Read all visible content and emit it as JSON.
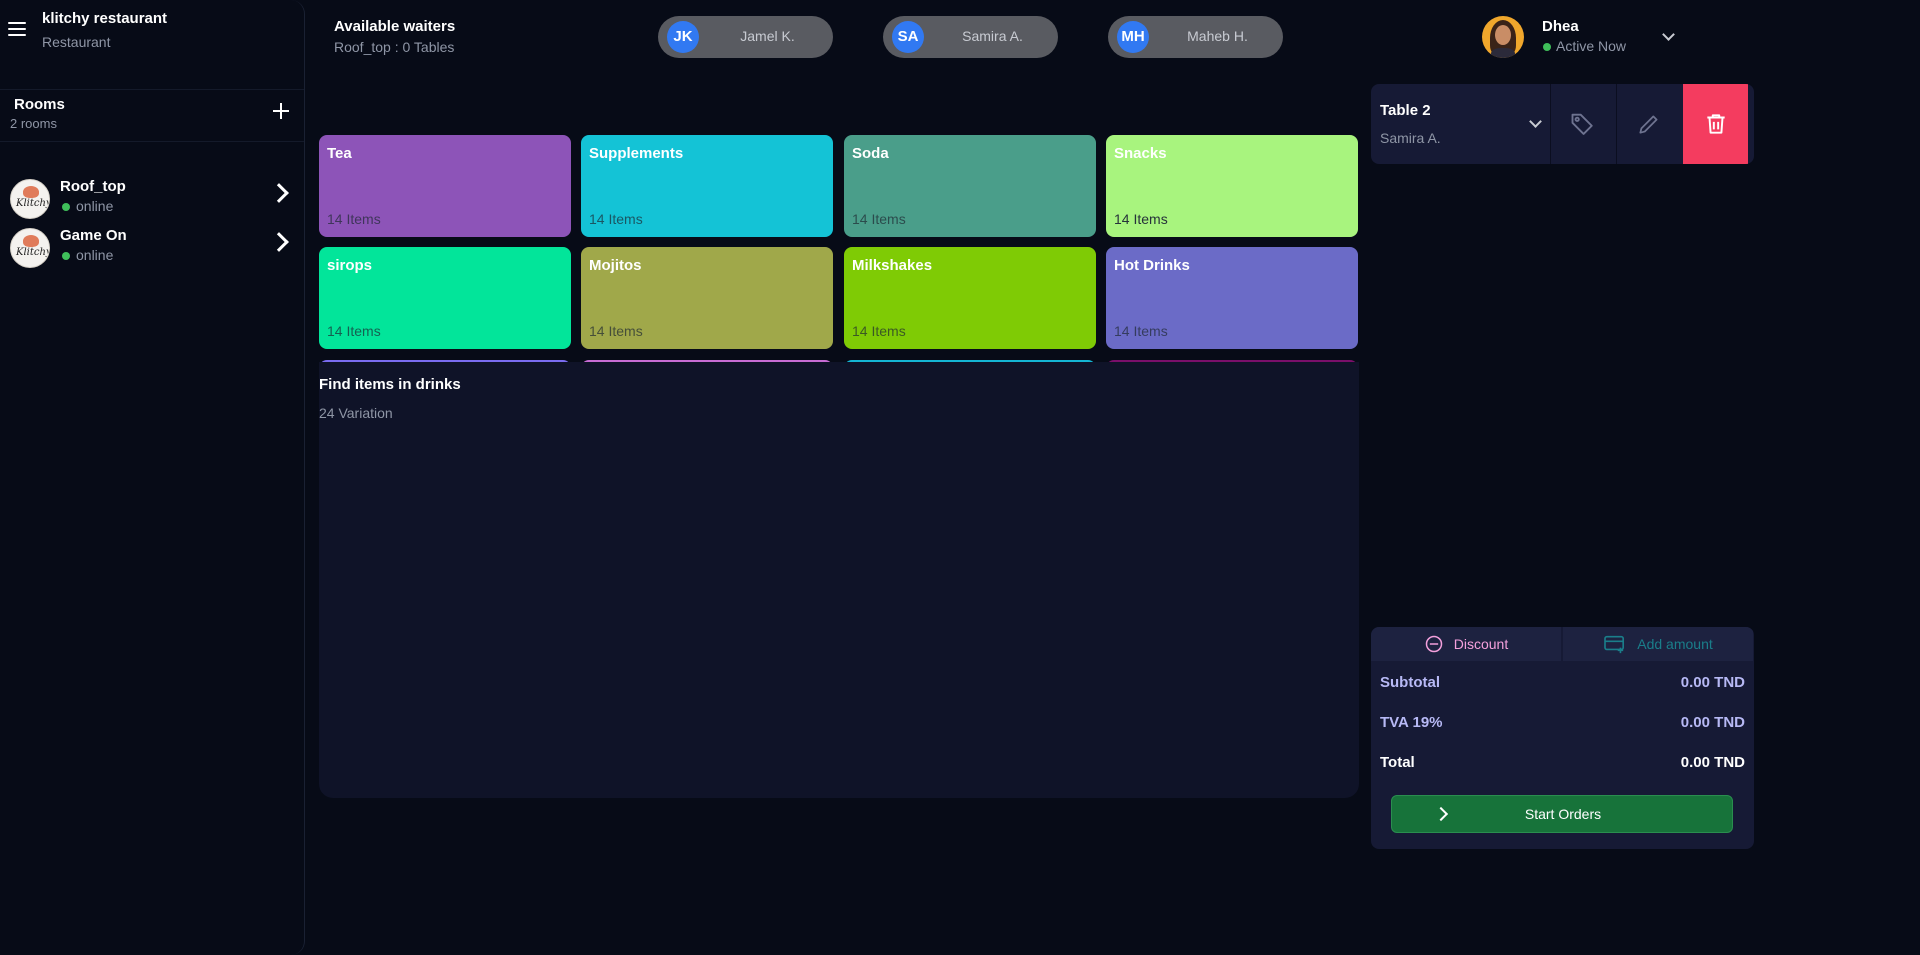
{
  "sidebar": {
    "brand_title": "klitchy restaurant",
    "brand_subtitle": "Restaurant",
    "rooms_title": "Rooms",
    "rooms_count": "2 rooms",
    "rooms": [
      {
        "name": "Roof_top",
        "status": "online",
        "logo_text": "Klitchy"
      },
      {
        "name": "Game On",
        "status": "online",
        "logo_text": "Klitchy"
      }
    ]
  },
  "header": {
    "waiters_title": "Available waiters",
    "waiters_subtitle": "Roof_top : 0 Tables",
    "waiters": [
      {
        "initials": "JK",
        "name": "Jamel K."
      },
      {
        "initials": "SA",
        "name": "Samira A."
      },
      {
        "initials": "MH",
        "name": "Maheb H."
      }
    ],
    "user": {
      "name": "Dhea",
      "status": "Active Now"
    }
  },
  "categories": [
    {
      "name": "Tea",
      "count": "14 Items",
      "color": "#8d54b8"
    },
    {
      "name": "Supplements",
      "count": "14 Items",
      "color": "#14c3d6"
    },
    {
      "name": "Soda",
      "count": "14 Items",
      "color": "#4a9e8a"
    },
    {
      "name": "Snacks",
      "count": "14 Items",
      "color": "#a8f47e"
    },
    {
      "name": "sirops",
      "count": "14 Items",
      "color": "#02e59a"
    },
    {
      "name": "Mojitos",
      "count": "14 Items",
      "color": "#a0a84a"
    },
    {
      "name": "Milkshakes",
      "count": "14 Items",
      "color": "#7fcb05"
    },
    {
      "name": "Hot Drinks",
      "count": "14 Items",
      "color": "#6b6bc7"
    },
    {
      "name": "",
      "count": "",
      "color": "#7a6cf0"
    },
    {
      "name": "",
      "count": "",
      "color": "#c86cd4"
    },
    {
      "name": "",
      "count": "",
      "color": "#14b5d3"
    },
    {
      "name": "",
      "count": "",
      "color": "#7a0f6a"
    }
  ],
  "find": {
    "title": "Find items in drinks",
    "subtitle": "24 Variation"
  },
  "order": {
    "table_name": "Table 2",
    "waiter": "Samira A.",
    "discount_label": "Discount",
    "add_amount_label": "Add amount",
    "subtotal_label": "Subtotal",
    "subtotal_value": "0.00 TND",
    "tva_label": "TVA 19%",
    "tva_value": "0.00 TND",
    "total_label": "Total",
    "total_value": "0.00 TND",
    "start_label": "Start Orders"
  },
  "colors": {
    "background": "#070b17",
    "panel": "#161a35",
    "accent_delete": "#f43c5f",
    "accent_start": "#17733a",
    "waiter_avatar": "#3179f2",
    "online": "#3fbf5a"
  },
  "icons": [
    "menu-icon",
    "plus-icon",
    "chevron-right-icon",
    "chevron-down-icon",
    "tag-icon",
    "pencil-icon",
    "trash-icon",
    "minus-circle-icon",
    "card-plus-icon"
  ]
}
